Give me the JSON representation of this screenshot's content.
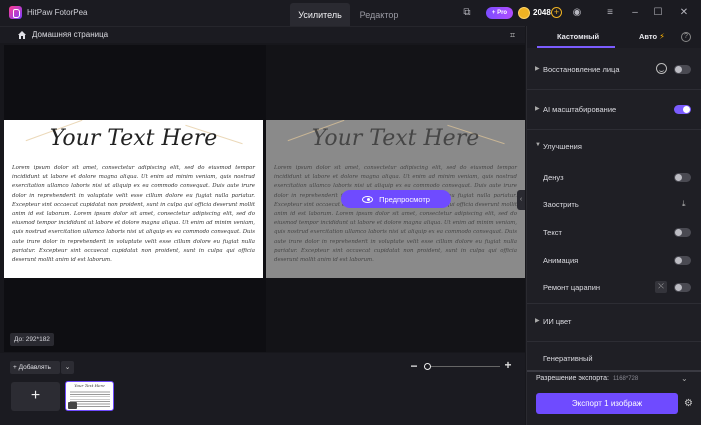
{
  "app": {
    "title": "HitPaw FotorPea"
  },
  "tabs": [
    "Усилитель",
    "Редактор"
  ],
  "badges": {
    "pro": "+ Pro",
    "credits": "2048"
  },
  "subbar": {
    "home_label": "Домашняя страница"
  },
  "canvas": {
    "document_title": "Your Text Here",
    "document_body": "Lorem ipsum dolor sit amet, consectetur adipiscing elit, sed do eiusmod tempor incididunt ut labore et dolore magna aliqua. Ut enim ad minim veniam, quis nostrud exercitation ullamco laboris nisi ut aliquip ex ea commodo consequat. Duis aute irure dolor in reprehenderit in voluptate velit esse cillum dolore eu fugiat nulla pariatur. Excepteur sint occaecat cupidatat non proident, sunt in culpa qui officia deserunt mollit anim id est laborum. Lorem ipsum dolor sit amet, consectetur adipiscing elit, sed do eiusmod tempor incididunt ut labore et dolore magna aliqua. Ut enim ad minim veniam, quis nostrud exercitation ullamco laboris nisi ut aliquip ex ea commodo consequat. Duis aute irure dolor in reprehenderit in voluptate velit esse cillum dolore eu fugiat nulla pariatur. Excepteur sint occaecat cupidatat non proident, sunt in culpa qui officia deserunt mollit anim id est laborum.",
    "preview_label": "Предпросмотр",
    "size_label": "До: 292*182"
  },
  "bottom": {
    "add_label": "+ Добавлять",
    "zoom_level": 0.0
  },
  "panel": {
    "tabs": {
      "custom": "Кастомный",
      "auto": "Авто"
    },
    "face_restore": "Восстановление лица",
    "ai_upscale": "AI масштабирование",
    "improvements": "Улучшения",
    "denoise": "Денуз",
    "sharpen": "Заострить",
    "text": "Текст",
    "animation": "Анимация",
    "scratch": "Ремонт царапин",
    "ai_color": "ИИ цвет",
    "generative": "Генеративный",
    "export_res_label": "Разрешение экспорта:",
    "export_res_value": "1168*728",
    "export_button": "Экспорт 1 изображ"
  }
}
